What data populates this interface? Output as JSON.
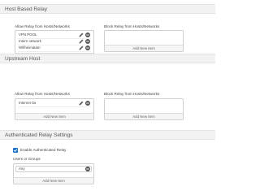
{
  "host_based_relay": {
    "title": "Host Based Relay",
    "allow_label": "Allow Relay from Hosts/Networks",
    "block_label": "Block Relay from Hosts/Networks",
    "allow_items": [
      {
        "label": "VPN POOL"
      },
      {
        "label": "Intern network"
      },
      {
        "label": "Wifiheimatam"
      }
    ],
    "allow_add_label": "Add New Item",
    "block_add_label": "Add New Item"
  },
  "upstream_host": {
    "title": "Upstream Host",
    "allow_label": "Allow Relay from Hosts/Networks",
    "block_label": "Block Relay from Hosts/Networks",
    "allow_items": [
      {
        "label": "Internet 0a"
      }
    ],
    "allow_add_label": "Add New Item",
    "block_add_label": "Add New Item"
  },
  "authenticated_relay": {
    "title": "Authenticated Relay Settings",
    "enable_label": "Enable Authenticated Relay",
    "enable_checked": true,
    "users_label": "Users or Groups",
    "users_value": "Any",
    "add_label": "Add New Item"
  },
  "colors": {
    "accent": "#1a73c8",
    "edit_icon": "#555555",
    "delete_icon": "#555555"
  }
}
